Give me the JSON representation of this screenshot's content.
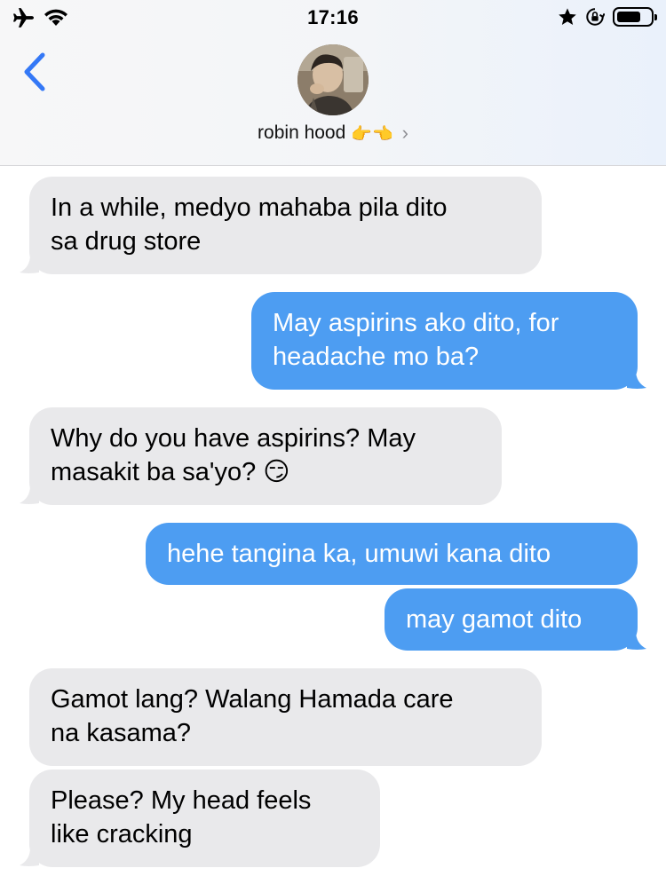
{
  "status_bar": {
    "time": "17:16",
    "left_icons": [
      "airplane-icon",
      "wifi-icon"
    ],
    "right_icons": [
      "star-icon",
      "rotation-lock-icon",
      "battery-icon"
    ]
  },
  "header": {
    "contact_name": "robin hood",
    "contact_emoji": "👉👈",
    "chevron": "›"
  },
  "colors": {
    "incoming_bubble": "#e9e9eb",
    "outgoing_bubble": "#4d9df2",
    "back_arrow": "#3478f6"
  },
  "messages": [
    {
      "direction": "incoming",
      "line1": "In a while, medyo mahaba pila dito",
      "line2": "sa drug store"
    },
    {
      "direction": "outgoing",
      "line1": "May aspirins ako dito, for",
      "line2": "headache mo ba?"
    },
    {
      "direction": "incoming",
      "line1": "Why do you have aspirins? May",
      "line2": "masakit ba sa'yo? 😏"
    },
    {
      "direction": "outgoing",
      "line1": "hehe tangina ka, umuwi kana dito"
    },
    {
      "direction": "outgoing",
      "line1": "may gamot dito"
    },
    {
      "direction": "incoming",
      "line1": "Gamot lang? Walang Hamada care",
      "line2": "na kasama?"
    },
    {
      "direction": "incoming",
      "line1": "Please? My head feels",
      "line2": "like cracking"
    }
  ]
}
